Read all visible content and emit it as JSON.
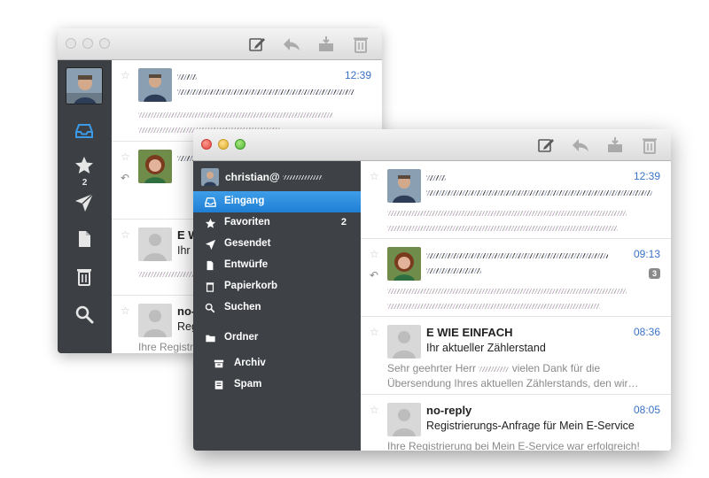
{
  "colors": {
    "accent": "#2a86dc",
    "sidebar": "#3e4247",
    "time": "#3a73c6"
  },
  "back_window": {
    "rail": {
      "favorites_badge": "2"
    },
    "messages": [
      {
        "sender": "",
        "time": "12:39"
      },
      {
        "sender": ""
      },
      {
        "sender": "E W",
        "subject": "Ihr"
      },
      {
        "sender": "no-",
        "subject": "Reg",
        "preview": "Ihre Registri"
      }
    ]
  },
  "front_window": {
    "account": {
      "name": "christian@"
    },
    "nav": [
      {
        "label": "Eingang",
        "icon": "inbox-icon"
      },
      {
        "label": "Favoriten",
        "icon": "star-icon",
        "badge": "2"
      },
      {
        "label": "Gesendet",
        "icon": "paper-plane-icon"
      },
      {
        "label": "Entwürfe",
        "icon": "document-icon"
      },
      {
        "label": "Papierkorb",
        "icon": "trash-icon"
      },
      {
        "label": "Suchen",
        "icon": "search-icon"
      },
      {
        "label": "Ordner",
        "icon": "folder-icon"
      },
      {
        "label": "Archiv",
        "icon": "archive-icon"
      },
      {
        "label": "Spam",
        "icon": "spam-icon"
      }
    ],
    "messages": [
      {
        "sender": "",
        "subject": "",
        "preview": "",
        "time": "12:39"
      },
      {
        "sender": "",
        "subject": "",
        "preview": "",
        "time": "09:13",
        "count": "3"
      },
      {
        "sender": "E WIE EINFACH",
        "subject": "Ihr aktueller Zählerstand",
        "preview_line1_start": "Sehr geehrter Herr",
        "preview_line1_end": "vielen Dank für die",
        "preview_line2": "Übersendung Ihres aktuellen Zählerstands, den wir…",
        "time": "08:36"
      },
      {
        "sender": "no-reply",
        "subject": "Registrierungs-Anfrage für Mein E-Service",
        "preview": "Ihre Registrierung bei Mein E-Service war erfolgreich!",
        "time": "08:05"
      }
    ]
  }
}
